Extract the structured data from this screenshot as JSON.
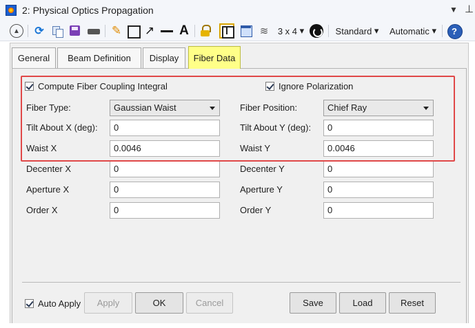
{
  "window": {
    "title": "2: Physical Optics Propagation"
  },
  "toolbar": {
    "grid_label": "3 x 4",
    "standard_label": "Standard",
    "automatic_label": "Automatic",
    "help_label": "?",
    "text_tool_label": "A"
  },
  "tabs": [
    {
      "label": "General"
    },
    {
      "label": "Beam Definition"
    },
    {
      "label": "Display"
    },
    {
      "label": "Fiber Data"
    }
  ],
  "active_tab": "Fiber Data",
  "fiber": {
    "compute_coupling_label": "Compute Fiber Coupling Integral",
    "compute_coupling_checked": true,
    "ignore_polarization_label": "Ignore Polarization",
    "ignore_polarization_checked": true,
    "fiber_type_label": "Fiber Type:",
    "fiber_type_value": "Gaussian Waist",
    "fiber_position_label": "Fiber Position:",
    "fiber_position_value": "Chief Ray",
    "tilt_x_label": "Tilt About X (deg):",
    "tilt_x_value": "0",
    "tilt_y_label": "Tilt About Y (deg):",
    "tilt_y_value": "0",
    "waist_x_label": "Waist X",
    "waist_x_value": "0.0046",
    "waist_y_label": "Waist Y",
    "waist_y_value": "0.0046",
    "decenter_x_label": "Decenter X",
    "decenter_x_value": "0",
    "decenter_y_label": "Decenter Y",
    "decenter_y_value": "0",
    "aperture_x_label": "Aperture X",
    "aperture_x_value": "0",
    "aperture_y_label": "Aperture Y",
    "aperture_y_value": "0",
    "order_x_label": "Order X",
    "order_x_value": "0",
    "order_y_label": "Order Y",
    "order_y_value": "0"
  },
  "footer": {
    "auto_apply_label": "Auto Apply",
    "auto_apply_checked": true,
    "apply_label": "Apply",
    "ok_label": "OK",
    "cancel_label": "Cancel",
    "save_label": "Save",
    "load_label": "Load",
    "reset_label": "Reset"
  },
  "colors": {
    "active_tab": "#ffff88",
    "highlight_border": "#e04848"
  }
}
